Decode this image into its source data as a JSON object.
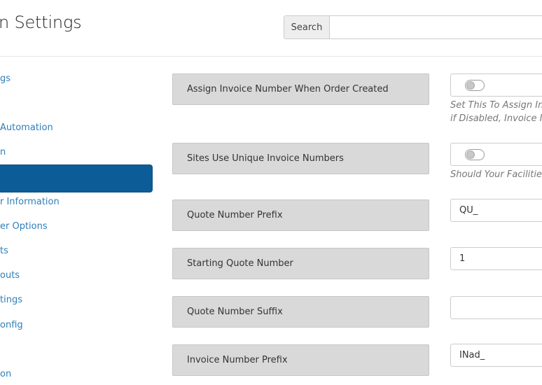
{
  "header": {
    "title": "n Settings",
    "search_label": "Search",
    "search_value": ""
  },
  "sidebar": {
    "items": [
      {
        "label": "gs"
      },
      {
        "label": "Automation"
      },
      {
        "label": "n"
      },
      {
        "label": ""
      },
      {
        "label": "r Information"
      },
      {
        "label": "er Options"
      },
      {
        "label": "ts"
      },
      {
        "label": "outs"
      },
      {
        "label": "tings"
      },
      {
        "label": "onfig"
      },
      {
        "label": "on"
      }
    ]
  },
  "settings": [
    {
      "label": "Assign Invoice Number When Order Created",
      "type": "toggle",
      "on": false,
      "help1": "Set This To Assign Inv",
      "help2": "if Disabled, Invoice Nur"
    },
    {
      "label": "Sites Use Unique Invoice Numbers",
      "type": "toggle",
      "on": false,
      "help1": "Should Your Facilities U"
    },
    {
      "label": "Quote Number Prefix",
      "type": "text",
      "value": "QU_"
    },
    {
      "label": "Starting Quote Number",
      "type": "text",
      "value": "1"
    },
    {
      "label": "Quote Number Suffix",
      "type": "text",
      "value": ""
    },
    {
      "label": "Invoice Number Prefix",
      "type": "text",
      "value": "INad_"
    }
  ]
}
